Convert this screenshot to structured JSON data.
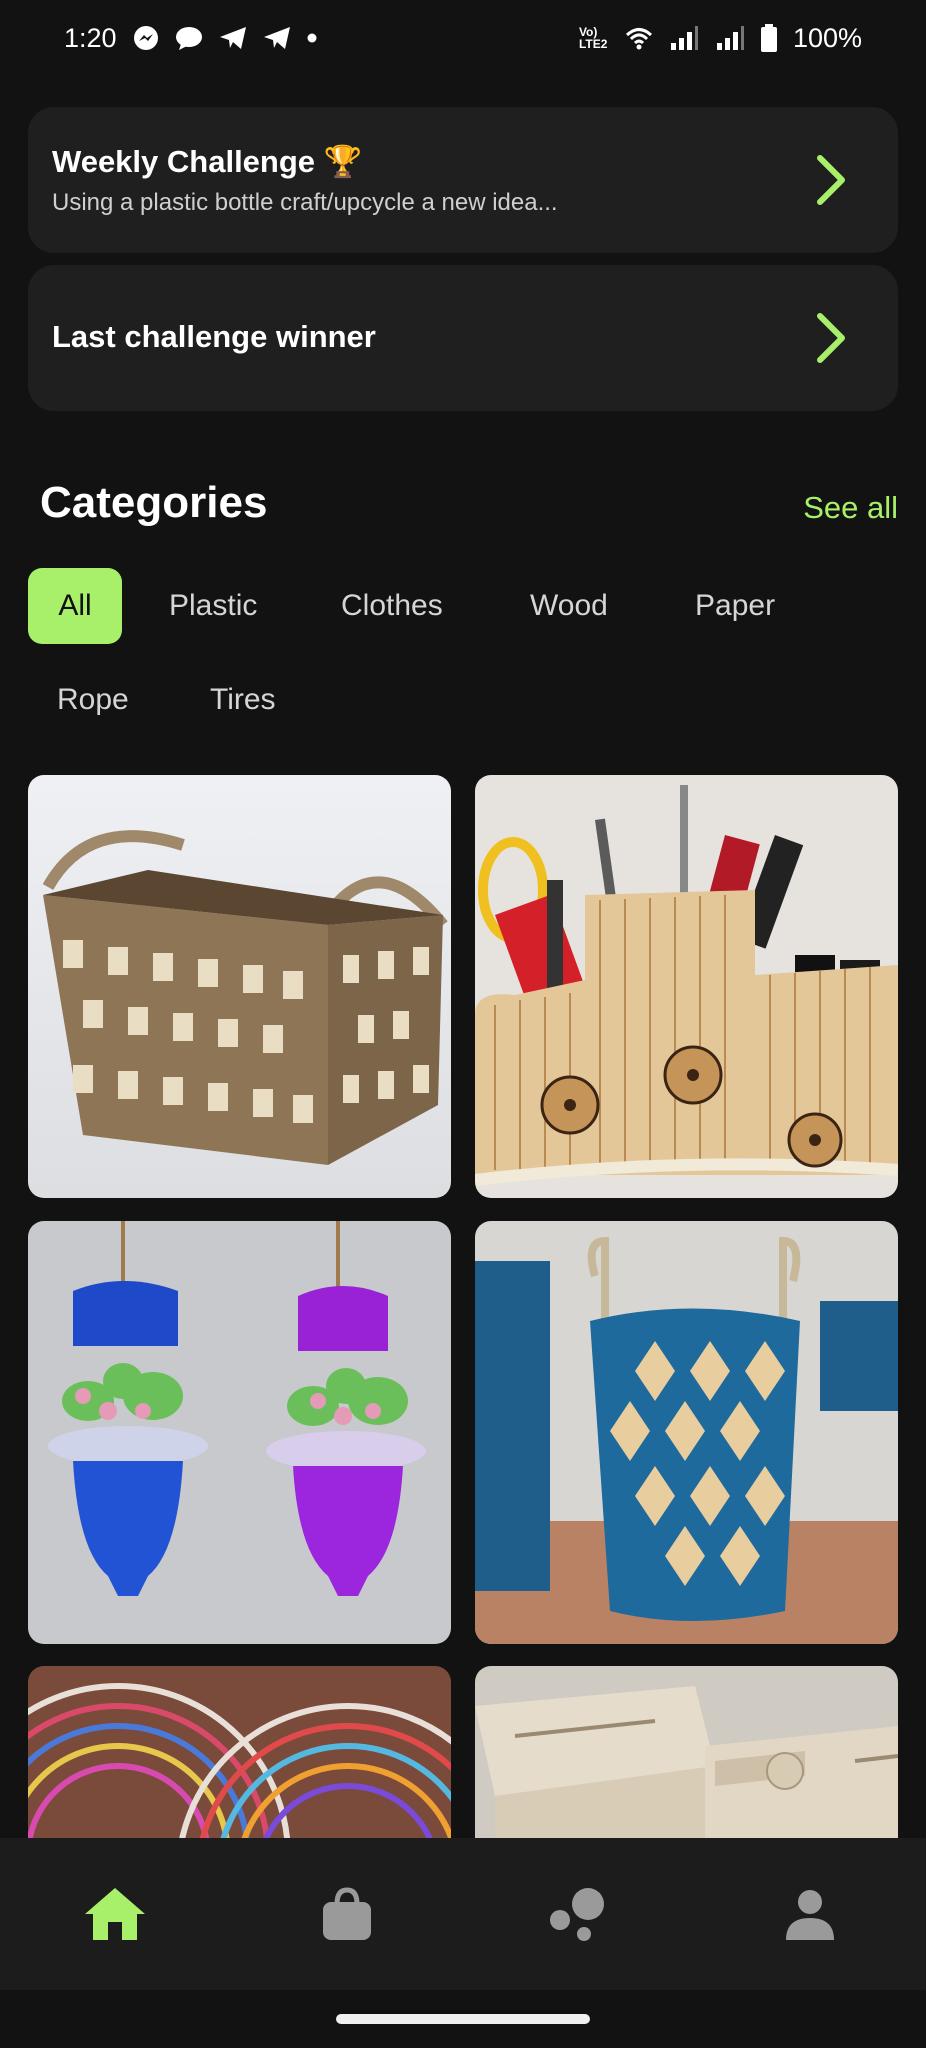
{
  "status_bar": {
    "time": "1:20",
    "battery": "100%",
    "network_label": "Vo) LTE2",
    "icons": [
      "messenger-icon",
      "chat-bubble-icon",
      "telegram-icon",
      "telegram-icon",
      "dot-icon",
      "volte-icon",
      "wifi-icon",
      "signal-icon",
      "signal-icon",
      "battery-icon"
    ]
  },
  "challenge": {
    "title": "Weekly Challenge 🏆",
    "subtitle": "Using a plastic bottle craft/upcycle a new idea..."
  },
  "winner": {
    "title": "Last challenge winner"
  },
  "categories": {
    "title": "Categories",
    "see_all": "See all",
    "chips": [
      "All",
      "Plastic",
      "Clothes",
      "Wood",
      "Paper",
      "Rope",
      "Tires"
    ],
    "active": "All"
  },
  "grid": {
    "items": [
      "rope-basket",
      "popsicle-stick-organizer",
      "plastic-bottle-planters",
      "paper-tube-basket",
      "paper-coil-bowls",
      "wooden-box"
    ]
  },
  "nav": {
    "items": [
      "home-icon",
      "shopping-bag-icon",
      "community-icon",
      "profile-icon"
    ],
    "active_color": "#a8f06a",
    "inactive_color": "#9a9a9a"
  },
  "colors": {
    "accent": "#a8f06a",
    "card_bg": "#1f1f1f",
    "bg": "#121212"
  }
}
